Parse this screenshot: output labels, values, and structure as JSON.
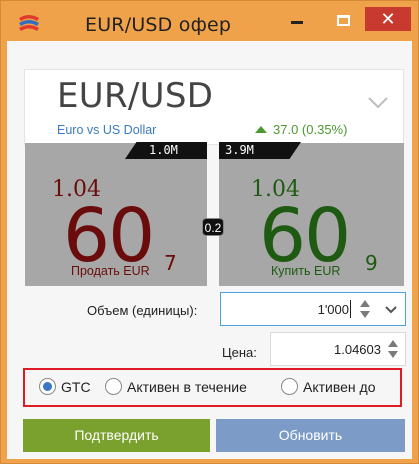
{
  "window": {
    "title": "EUR/USD офер"
  },
  "header": {
    "symbol": "EUR/USD",
    "description": "Euro vs US Dollar",
    "change": "37.0 (0.35%)"
  },
  "sell": {
    "volume": "1.0M",
    "price_prefix": "1.04",
    "price_big": "60",
    "price_pip": "7",
    "label": "Продать EUR"
  },
  "buy": {
    "volume": "3.9M",
    "price_prefix": "1.04",
    "price_big": "60",
    "price_pip": "9",
    "label": "Купить EUR"
  },
  "spread": "0.2",
  "volume_field": {
    "label": "Объем (единицы):",
    "value": "1'000"
  },
  "price_field": {
    "label": "Цена:",
    "value": "1.04603"
  },
  "expiry": {
    "options": [
      "GTC",
      "Активен в течение",
      "Активен до"
    ],
    "selected": "GTC"
  },
  "buttons": {
    "confirm": "Подтвердить",
    "refresh": "Обновить"
  },
  "colors": {
    "title_bar": "#f0a24a",
    "sell_text": "#6b0c0c",
    "buy_text": "#1e5a12",
    "tile_bg": "#a7a7a7",
    "confirm_button": "#7aa02d",
    "refresh_button": "#7c9cc7",
    "highlight": "#e01b24"
  },
  "icons": {
    "app": "app-logo-icon",
    "change_direction": "arrow-up-icon",
    "expand": "chevron-down-icon"
  }
}
